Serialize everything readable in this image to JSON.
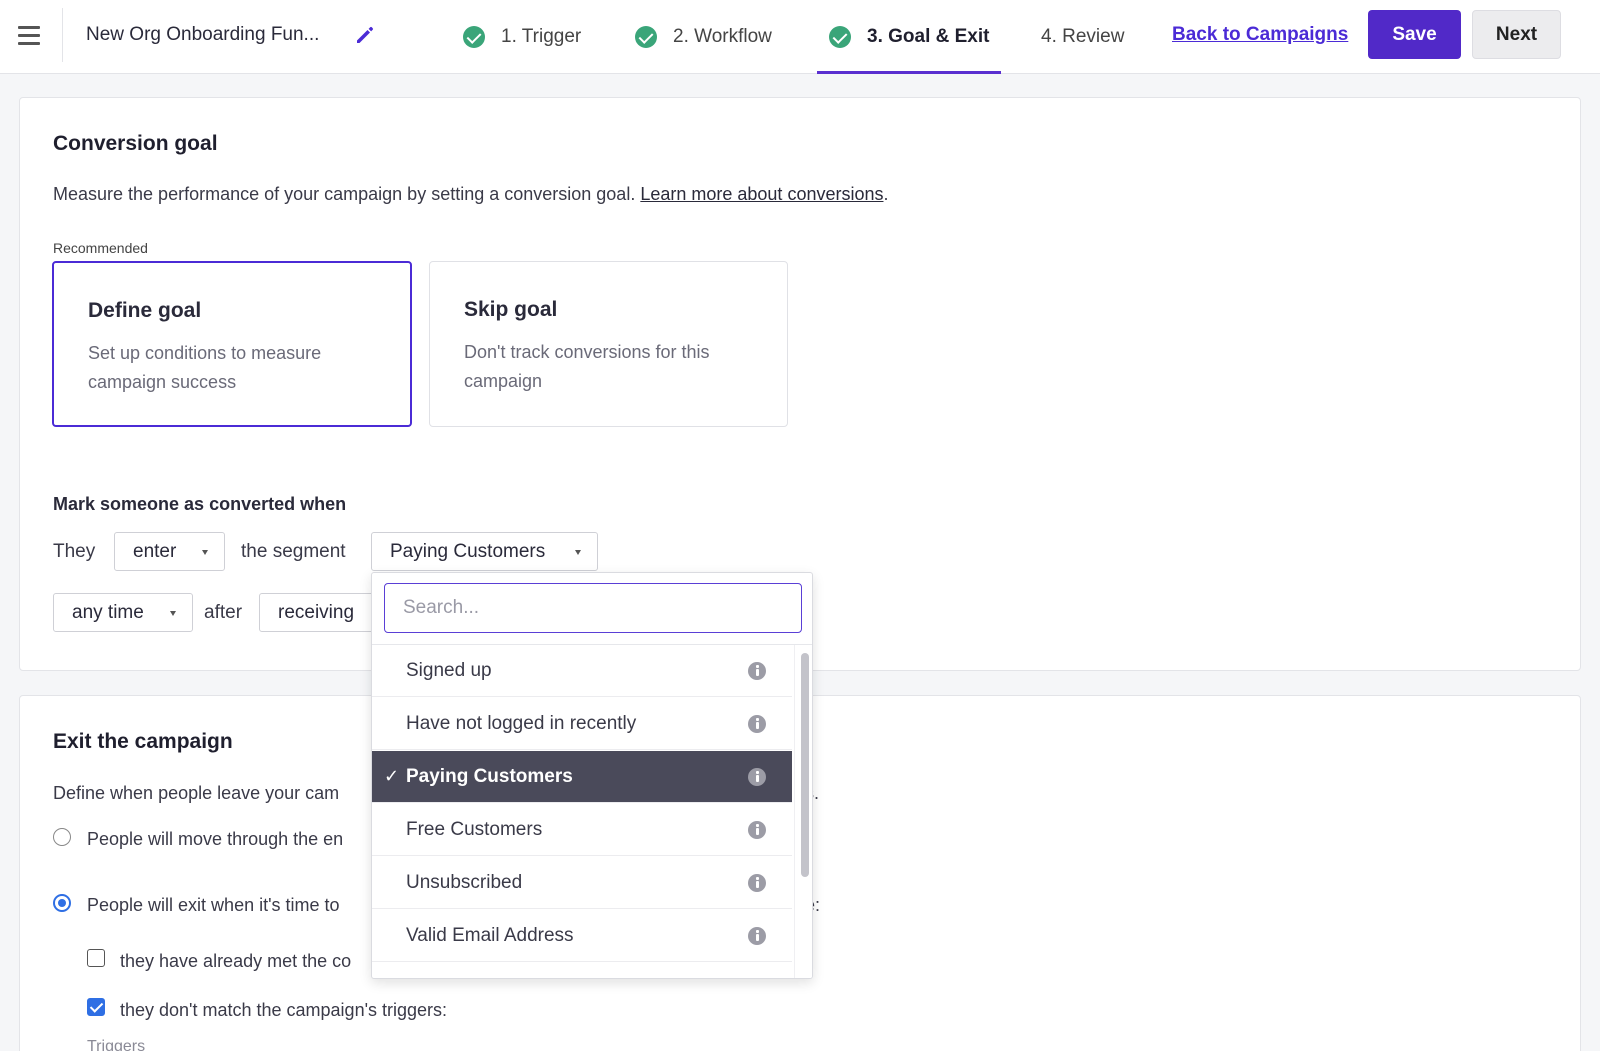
{
  "header": {
    "campaign_name": "New Org Onboarding Fun...",
    "steps": [
      {
        "label": "1. Trigger"
      },
      {
        "label": "2. Workflow"
      },
      {
        "label": "3. Goal & Exit"
      },
      {
        "label": "4. Review"
      }
    ],
    "back_link": "Back to Campaigns",
    "save_label": "Save",
    "next_label": "Next"
  },
  "conversion": {
    "title": "Conversion goal",
    "description": "Measure the performance of your campaign by setting a conversion goal.",
    "learn_more": "Learn more about conversions",
    "period": ".",
    "recommended": "Recommended",
    "define": {
      "title": "Define goal",
      "desc": "Set up conditions to measure campaign success"
    },
    "skip": {
      "title": "Skip goal",
      "desc": "Don't track conversions for this campaign"
    },
    "mark_title": "Mark someone as converted when",
    "they": "They",
    "enter_select": "enter",
    "the_segment": "the segment",
    "segment_select": "Paying Customers",
    "time_select": "any time",
    "after": "after",
    "receiving_select": "receiving"
  },
  "exit": {
    "title": "Exit the campaign",
    "description": "Define when people leave your cam",
    "description_tail": "s.",
    "option1": "People will move through the en",
    "option2": "People will exit when it's time to",
    "option2_tail": "e:",
    "check1": "they have already met the co",
    "check2": "they don't match the campaign's triggers:",
    "triggers_label": "Triggers"
  },
  "dropdown": {
    "placeholder": "Search...",
    "items": [
      {
        "label": "Signed up"
      },
      {
        "label": "Have not logged in recently"
      },
      {
        "label": "Paying Customers"
      },
      {
        "label": "Free Customers"
      },
      {
        "label": "Unsubscribed"
      },
      {
        "label": "Valid Email Address"
      }
    ],
    "check_mark": "✓"
  },
  "colors": {
    "accent": "#5129c8",
    "check_green": "#3aa579",
    "selected_row": "#4a4a5a",
    "radio_blue": "#2f6fe4"
  }
}
